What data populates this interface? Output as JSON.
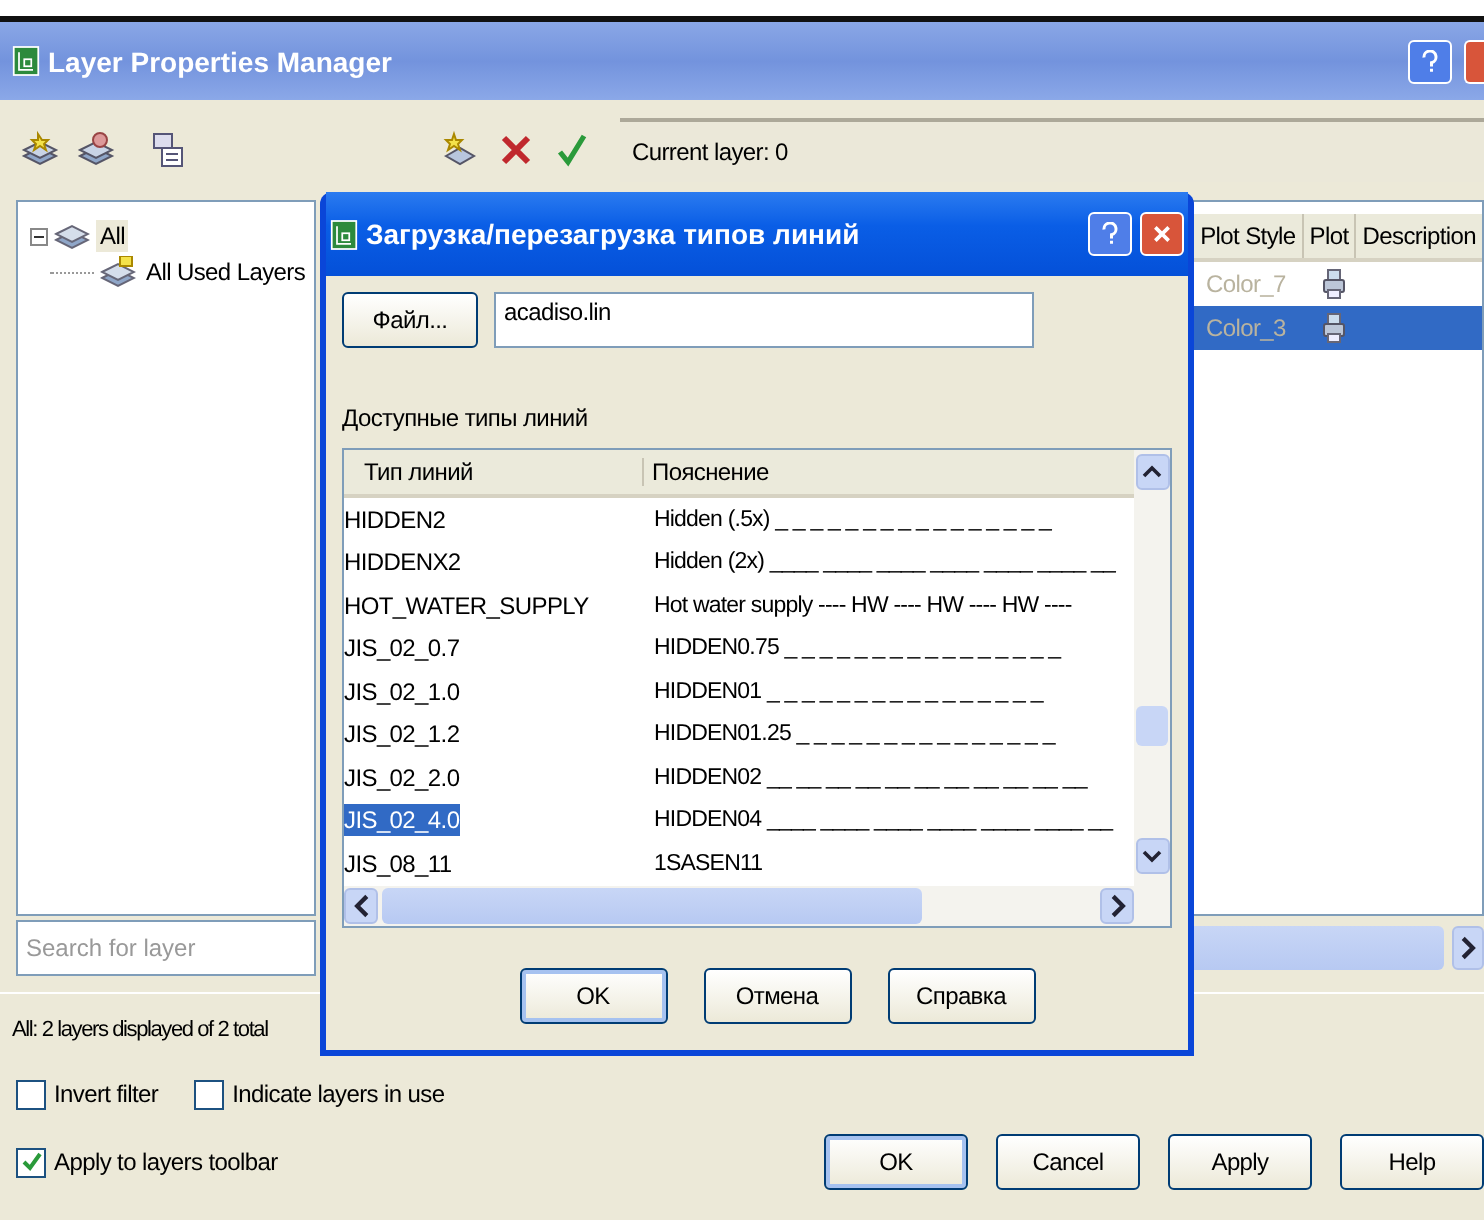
{
  "window": {
    "title": "Layer Properties Manager"
  },
  "current_layer": "Current layer: 0",
  "filter_tree": [
    {
      "label": "All",
      "selected": true,
      "expanded": true,
      "children": [
        {
          "label": "All Used Layers",
          "selected": false
        }
      ]
    }
  ],
  "layer_grid": {
    "columns": [
      "Plot Style",
      "Plot",
      "Description"
    ],
    "rows": [
      {
        "plot_style": "Color_7",
        "selected": false
      },
      {
        "plot_style": "Color_3",
        "selected": true
      }
    ]
  },
  "search": {
    "placeholder": "Search for layer"
  },
  "status": "All: 2 layers displayed of 2 total",
  "options": [
    {
      "label": "Invert filter",
      "checked": false
    },
    {
      "label": "Indicate layers in use",
      "checked": false
    },
    {
      "label": "Apply to layers toolbar",
      "checked": true
    }
  ],
  "buttons": [
    "OK",
    "Cancel",
    "Apply",
    "Help"
  ],
  "dialog": {
    "title": "Загрузка/перезагрузка типов линий",
    "file_button": "Файл...",
    "file_value": "acadiso.lin",
    "list_label": "Доступные типы линий",
    "columns": [
      "Тип линий",
      "Пояснение"
    ],
    "rows": [
      {
        "name": "HIDDEN2",
        "description": "Hidden (.5x) _ _ _ _ _ _ _ _ _ _ _ _ _ _ _ _",
        "selected": false
      },
      {
        "name": "HIDDENX2",
        "description": "Hidden (2x) ____ ____ ____ ____ ____ ____ __",
        "selected": false
      },
      {
        "name": "HOT_WATER_SUPPLY",
        "description": "Hot water supply ---- HW ---- HW ---- HW ----",
        "selected": false
      },
      {
        "name": "JIS_02_0.7",
        "description": "HIDDEN0.75 _ _ _ _ _ _ _ _ _ _ _ _ _ _ _ _",
        "selected": false
      },
      {
        "name": "JIS_02_1.0",
        "description": "HIDDEN01 _ _ _ _ _ _ _ _ _ _ _ _ _ _ _ _",
        "selected": false
      },
      {
        "name": "JIS_02_1.2",
        "description": "HIDDEN01.25 _ _ _ _ _ _ _ _ _ _ _ _ _ _ _",
        "selected": false
      },
      {
        "name": "JIS_02_2.0",
        "description": "HIDDEN02 __ __ __ __ __ __ __ __ __ __ __",
        "selected": false
      },
      {
        "name": "JIS_02_4.0",
        "description": "HIDDEN04 ____ ____ ____ ____ ____ ____ __",
        "selected": true
      },
      {
        "name": "JIS_08_11",
        "description": "1SASEN11",
        "selected": false
      }
    ],
    "buttons": [
      "OK",
      "Отмена",
      "Справка"
    ]
  }
}
